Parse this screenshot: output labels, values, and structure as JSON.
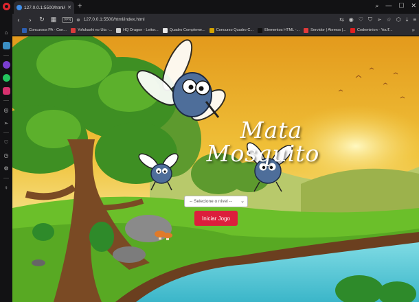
{
  "browser": {
    "tab_title": "127.0.0.1:5500/html/index",
    "url": "127.0.0.1:5500/html/index.html",
    "vpn_label": "VPN",
    "bookmarks": [
      {
        "label": "Concursos PA - Con...",
        "color": "#2d5fb3"
      },
      {
        "label": "Yofukashi no Uta -...",
        "color": "#d83b3b"
      },
      {
        "label": "HQ Dragon - Leitor...",
        "color": "#cfcfcf"
      },
      {
        "label": "Quadro Compleme...",
        "color": "#e8e8e8"
      },
      {
        "label": "Concurso Quadro C...",
        "color": "#d4a300"
      },
      {
        "label": "Elementos HTML -...",
        "color": "#111111"
      },
      {
        "label": "Servidor | Atemos |...",
        "color": "#e23a3a"
      },
      {
        "label": "Codeminion - YouT...",
        "color": "#e02020"
      }
    ]
  },
  "game": {
    "title_line1": "Mata",
    "title_line2": "Mosquito",
    "level_placeholder": "-- Selecione o nível --",
    "start_button": "Iniciar Jogo"
  },
  "colors": {
    "start_button": "#dc1e3c",
    "sky_top": "#e8a21e",
    "grass": "#6bbf2a",
    "water": "#5ec9d8"
  }
}
